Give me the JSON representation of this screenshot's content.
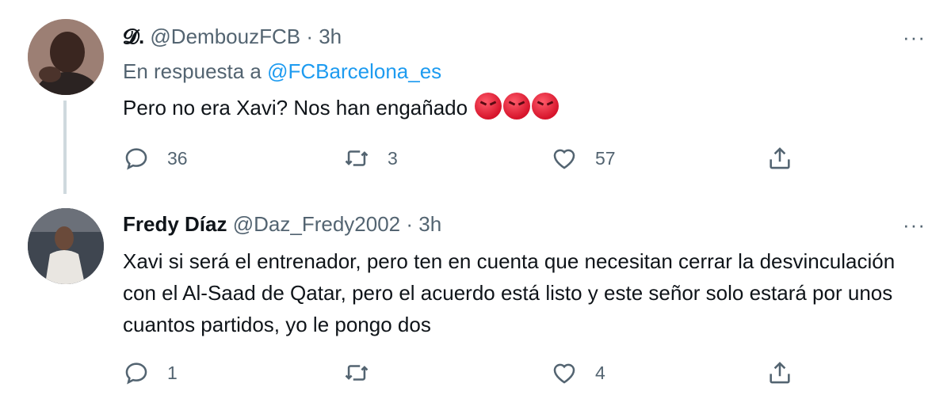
{
  "tweets": [
    {
      "display_name": "𝓓.",
      "handle": "@DembouzFCB",
      "separator": "·",
      "time": "3h",
      "reply_prefix": "En respuesta a",
      "reply_mention": "@FCBarcelona_es",
      "text": "Pero no era Xavi? Nos han engañado",
      "emoji": "angry-face x3",
      "replies": "36",
      "retweets": "3",
      "likes": "57",
      "more": "···"
    },
    {
      "display_name": "Fredy Díaz",
      "handle": "@Daz_Fredy2002",
      "separator": "·",
      "time": "3h",
      "text": "Xavi si será el entrenador, pero ten en cuenta que necesitan cerrar la desvinculación con el Al-Saad de Qatar, pero el acuerdo está listo y este señor solo estará por unos cuantos partidos, yo le pongo dos",
      "replies": "1",
      "retweets": "",
      "likes": "4",
      "more": "···"
    }
  ],
  "colors": {
    "text": "#0f1419",
    "secondary": "#536471",
    "link": "#1d9bf0",
    "thread_line": "#cfd9de"
  },
  "icons": [
    "reply-icon",
    "retweet-icon",
    "like-icon",
    "share-icon",
    "more-icon",
    "angry-face-emoji"
  ]
}
